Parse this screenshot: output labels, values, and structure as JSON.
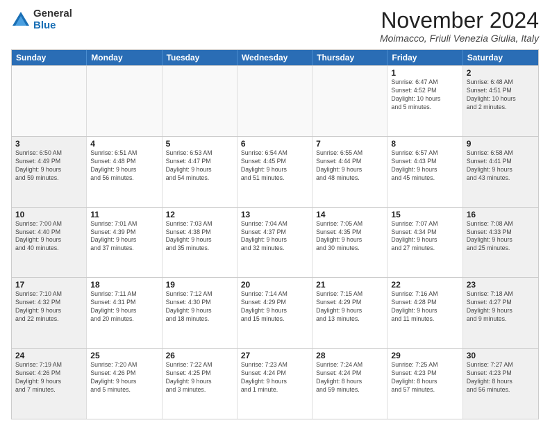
{
  "logo": {
    "general": "General",
    "blue": "Blue"
  },
  "title": "November 2024",
  "subtitle": "Moimacco, Friuli Venezia Giulia, Italy",
  "days": [
    "Sunday",
    "Monday",
    "Tuesday",
    "Wednesday",
    "Thursday",
    "Friday",
    "Saturday"
  ],
  "weeks": [
    [
      {
        "day": "",
        "info": ""
      },
      {
        "day": "",
        "info": ""
      },
      {
        "day": "",
        "info": ""
      },
      {
        "day": "",
        "info": ""
      },
      {
        "day": "",
        "info": ""
      },
      {
        "day": "1",
        "info": "Sunrise: 6:47 AM\nSunset: 4:52 PM\nDaylight: 10 hours\nand 5 minutes."
      },
      {
        "day": "2",
        "info": "Sunrise: 6:48 AM\nSunset: 4:51 PM\nDaylight: 10 hours\nand 2 minutes."
      }
    ],
    [
      {
        "day": "3",
        "info": "Sunrise: 6:50 AM\nSunset: 4:49 PM\nDaylight: 9 hours\nand 59 minutes."
      },
      {
        "day": "4",
        "info": "Sunrise: 6:51 AM\nSunset: 4:48 PM\nDaylight: 9 hours\nand 56 minutes."
      },
      {
        "day": "5",
        "info": "Sunrise: 6:53 AM\nSunset: 4:47 PM\nDaylight: 9 hours\nand 54 minutes."
      },
      {
        "day": "6",
        "info": "Sunrise: 6:54 AM\nSunset: 4:45 PM\nDaylight: 9 hours\nand 51 minutes."
      },
      {
        "day": "7",
        "info": "Sunrise: 6:55 AM\nSunset: 4:44 PM\nDaylight: 9 hours\nand 48 minutes."
      },
      {
        "day": "8",
        "info": "Sunrise: 6:57 AM\nSunset: 4:43 PM\nDaylight: 9 hours\nand 45 minutes."
      },
      {
        "day": "9",
        "info": "Sunrise: 6:58 AM\nSunset: 4:41 PM\nDaylight: 9 hours\nand 43 minutes."
      }
    ],
    [
      {
        "day": "10",
        "info": "Sunrise: 7:00 AM\nSunset: 4:40 PM\nDaylight: 9 hours\nand 40 minutes."
      },
      {
        "day": "11",
        "info": "Sunrise: 7:01 AM\nSunset: 4:39 PM\nDaylight: 9 hours\nand 37 minutes."
      },
      {
        "day": "12",
        "info": "Sunrise: 7:03 AM\nSunset: 4:38 PM\nDaylight: 9 hours\nand 35 minutes."
      },
      {
        "day": "13",
        "info": "Sunrise: 7:04 AM\nSunset: 4:37 PM\nDaylight: 9 hours\nand 32 minutes."
      },
      {
        "day": "14",
        "info": "Sunrise: 7:05 AM\nSunset: 4:35 PM\nDaylight: 9 hours\nand 30 minutes."
      },
      {
        "day": "15",
        "info": "Sunrise: 7:07 AM\nSunset: 4:34 PM\nDaylight: 9 hours\nand 27 minutes."
      },
      {
        "day": "16",
        "info": "Sunrise: 7:08 AM\nSunset: 4:33 PM\nDaylight: 9 hours\nand 25 minutes."
      }
    ],
    [
      {
        "day": "17",
        "info": "Sunrise: 7:10 AM\nSunset: 4:32 PM\nDaylight: 9 hours\nand 22 minutes."
      },
      {
        "day": "18",
        "info": "Sunrise: 7:11 AM\nSunset: 4:31 PM\nDaylight: 9 hours\nand 20 minutes."
      },
      {
        "day": "19",
        "info": "Sunrise: 7:12 AM\nSunset: 4:30 PM\nDaylight: 9 hours\nand 18 minutes."
      },
      {
        "day": "20",
        "info": "Sunrise: 7:14 AM\nSunset: 4:29 PM\nDaylight: 9 hours\nand 15 minutes."
      },
      {
        "day": "21",
        "info": "Sunrise: 7:15 AM\nSunset: 4:29 PM\nDaylight: 9 hours\nand 13 minutes."
      },
      {
        "day": "22",
        "info": "Sunrise: 7:16 AM\nSunset: 4:28 PM\nDaylight: 9 hours\nand 11 minutes."
      },
      {
        "day": "23",
        "info": "Sunrise: 7:18 AM\nSunset: 4:27 PM\nDaylight: 9 hours\nand 9 minutes."
      }
    ],
    [
      {
        "day": "24",
        "info": "Sunrise: 7:19 AM\nSunset: 4:26 PM\nDaylight: 9 hours\nand 7 minutes."
      },
      {
        "day": "25",
        "info": "Sunrise: 7:20 AM\nSunset: 4:26 PM\nDaylight: 9 hours\nand 5 minutes."
      },
      {
        "day": "26",
        "info": "Sunrise: 7:22 AM\nSunset: 4:25 PM\nDaylight: 9 hours\nand 3 minutes."
      },
      {
        "day": "27",
        "info": "Sunrise: 7:23 AM\nSunset: 4:24 PM\nDaylight: 9 hours\nand 1 minute."
      },
      {
        "day": "28",
        "info": "Sunrise: 7:24 AM\nSunset: 4:24 PM\nDaylight: 8 hours\nand 59 minutes."
      },
      {
        "day": "29",
        "info": "Sunrise: 7:25 AM\nSunset: 4:23 PM\nDaylight: 8 hours\nand 57 minutes."
      },
      {
        "day": "30",
        "info": "Sunrise: 7:27 AM\nSunset: 4:23 PM\nDaylight: 8 hours\nand 56 minutes."
      }
    ]
  ]
}
